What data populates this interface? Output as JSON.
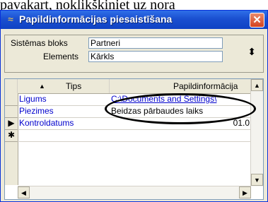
{
  "background_text": "pavakart, noklikšķiniet uz nora",
  "window": {
    "title": "Papildinformācijas piesaistīšana",
    "close_glyph": "✕"
  },
  "top_panel": {
    "system_block_label": "Sistēmas bloks",
    "system_block_value": "Partneri",
    "element_label": "Elements",
    "element_value": "Kārkls",
    "spinner_glyph": "⬍"
  },
  "grid": {
    "columns": [
      {
        "label": "Tips",
        "sort_glyph": "▲"
      },
      {
        "label": "Papildinformācija"
      }
    ],
    "rows": [
      {
        "type": "Ligums",
        "info": "C:\\Documents and Settings\\"
      },
      {
        "type": "Piezimes",
        "info": "Beidzas pārbaudes laiks"
      },
      {
        "type": "Kontroldatums",
        "info": "01.0"
      }
    ],
    "current_row_marker": "▶",
    "new_row_marker": "✱"
  },
  "scroll": {
    "up": "▲",
    "down": "▼",
    "left": "◀",
    "right": "▶"
  }
}
